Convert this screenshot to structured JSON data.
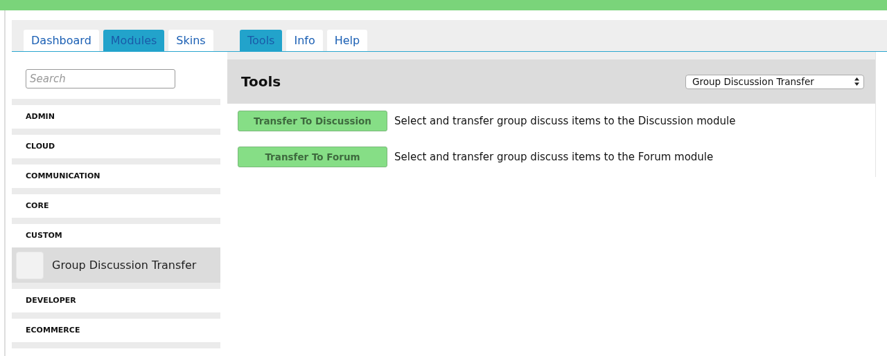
{
  "nav_tabs": [
    {
      "label": "Dashboard",
      "selected": false
    },
    {
      "label": "Modules",
      "selected": true
    },
    {
      "label": "Skins",
      "selected": false
    }
  ],
  "module_tabs": [
    {
      "label": "Tools",
      "selected": true
    },
    {
      "label": "Info",
      "selected": false
    },
    {
      "label": "Help",
      "selected": false
    }
  ],
  "sidebar": {
    "search": {
      "placeholder": "Search"
    },
    "categories": [
      {
        "label": "ADMIN"
      },
      {
        "label": "CLOUD"
      },
      {
        "label": "COMMUNICATION"
      },
      {
        "label": "CORE"
      },
      {
        "label": "CUSTOM",
        "children": [
          {
            "label": "Group Discussion Transfer",
            "selected": true
          }
        ]
      },
      {
        "label": "DEVELOPER"
      },
      {
        "label": "ECOMMERCE"
      }
    ]
  },
  "panel": {
    "title": "Tools",
    "tool_select": {
      "value": "Group Discussion Transfer"
    },
    "tools": [
      {
        "button": "Transfer To Discussion",
        "description": "Select and transfer group discuss items to the Discussion module"
      },
      {
        "button": "Transfer To Forum",
        "description": "Select and transfer group discuss items to the Forum module"
      }
    ]
  }
}
